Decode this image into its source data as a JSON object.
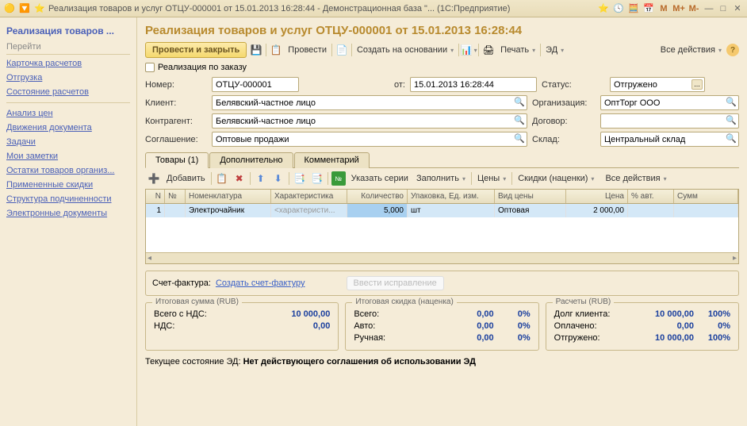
{
  "titlebar": {
    "text": "Реализация товаров и услуг ОТЦУ-000001 от 15.01.2013 16:28:44 - Демонстрационная база \"... (1С:Предприятие)",
    "mem": [
      "M",
      "M+",
      "M-"
    ]
  },
  "sidebar": {
    "header": "Реализация товаров ...",
    "section": "Перейти",
    "group1": [
      "Карточка расчетов",
      "Отгрузка",
      "Состояние расчетов"
    ],
    "group2": [
      "Анализ цен",
      "Движения документа",
      "Задачи",
      "Мои заметки",
      "Остатки товаров организ...",
      "Примененные скидки",
      "Структура подчиненности",
      "Электронные документы"
    ]
  },
  "page": {
    "title": "Реализация товаров и услуг ОТЦУ-000001 от 15.01.2013 16:28:44"
  },
  "toolbar": {
    "post_close": "Провести и закрыть",
    "post": "Провести",
    "create_based": "Создать на основании",
    "print": "Печать",
    "ed": "ЭД",
    "all_actions": "Все действия"
  },
  "check": {
    "by_order": "Реализация по заказу"
  },
  "fields": {
    "number_l": "Номер:",
    "number": "ОТЦУ-000001",
    "from_l": "от:",
    "date": "15.01.2013 16:28:44",
    "status_l": "Статус:",
    "status": "Отгружено",
    "client_l": "Клиент:",
    "client": "Белявский-частное лицо",
    "org_l": "Организация:",
    "org": "ОптТорг ООО",
    "contr_l": "Контрагент:",
    "contr": "Белявский-частное лицо",
    "dogovor_l": "Договор:",
    "dogovor": "",
    "sogl_l": "Соглашение:",
    "sogl": "Оптовые продажи",
    "sklad_l": "Склад:",
    "sklad": "Центральный склад"
  },
  "tabs": {
    "t1": "Товары (1)",
    "t2": "Дополнительно",
    "t3": "Комментарий"
  },
  "subtoolbar": {
    "add": "Добавить",
    "series": "Указать серии",
    "fill": "Заполнить",
    "prices": "Цены",
    "discounts": "Скидки (наценки)",
    "all": "Все действия"
  },
  "grid": {
    "headers": {
      "n": "N",
      "nom": "Номенклатура",
      "char": "Характеристика",
      "qty": "Количество",
      "pack": "Упаковка, Ед. изм.",
      "ptype": "Вид цены",
      "price": "Цена",
      "auto": "% авт.",
      "sum": "Сумм"
    },
    "row": {
      "n": "1",
      "nom": "Электрочайник",
      "char": "<характеристи...",
      "qty": "5,000",
      "pack": "шт",
      "ptype": "Оптовая",
      "price": "2 000,00",
      "auto": "",
      "sum": ""
    }
  },
  "sf": {
    "label": "Счет-фактура:",
    "link": "Создать счет-фактуру",
    "corr": "Ввести исправление"
  },
  "totals": {
    "b1": {
      "legend": "Итоговая сумма (RUB)",
      "r1l": "Всего с НДС:",
      "r1v": "10 000,00",
      "r2l": "НДС:",
      "r2v": "0,00"
    },
    "b2": {
      "legend": "Итоговая скидка (наценка)",
      "r1l": "Всего:",
      "r1v": "0,00",
      "r1p": "0%",
      "r2l": "Авто:",
      "r2v": "0,00",
      "r2p": "0%",
      "r3l": "Ручная:",
      "r3v": "0,00",
      "r3p": "0%"
    },
    "b3": {
      "legend": "Расчеты (RUB)",
      "r1l": "Долг клиента:",
      "r1v": "10 000,00",
      "r1p": "100%",
      "r2l": "Оплачено:",
      "r2v": "0,00",
      "r2p": "0%",
      "r3l": "Отгружено:",
      "r3v": "10 000,00",
      "r3p": "100%"
    }
  },
  "ed": {
    "label": "Текущее состояние ЭД:",
    "status": "Нет действующего соглашения об использовании ЭД"
  }
}
